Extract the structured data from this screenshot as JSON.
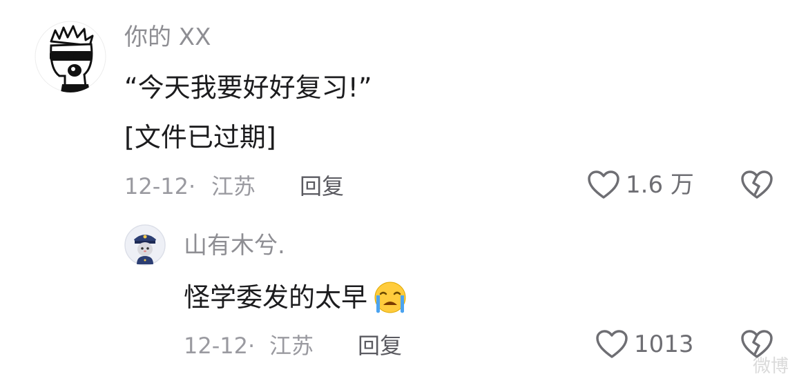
{
  "comment": {
    "username": "你的 XX",
    "text_line1": "“今天我要好好复习!”",
    "text_line2": "[文件已过期]",
    "date": "12-12·",
    "location": "江苏",
    "reply_label": "回复",
    "like_count": "1.6 万",
    "avatar_icon": "sunglasses-cartoon-avatar",
    "like_icon": "heart-outline-icon",
    "dislike_icon": "broken-heart-icon"
  },
  "reply": {
    "username": "山有木兮.",
    "text": "怪学委发的太早",
    "emoji_icon": "crying-face-emoji",
    "date": "12-12·",
    "location": "江苏",
    "reply_label": "回复",
    "like_count": "1013",
    "avatar_icon": "police-rabbit-avatar",
    "like_icon": "heart-outline-icon",
    "dislike_icon": "broken-heart-icon"
  },
  "watermark": "微博"
}
